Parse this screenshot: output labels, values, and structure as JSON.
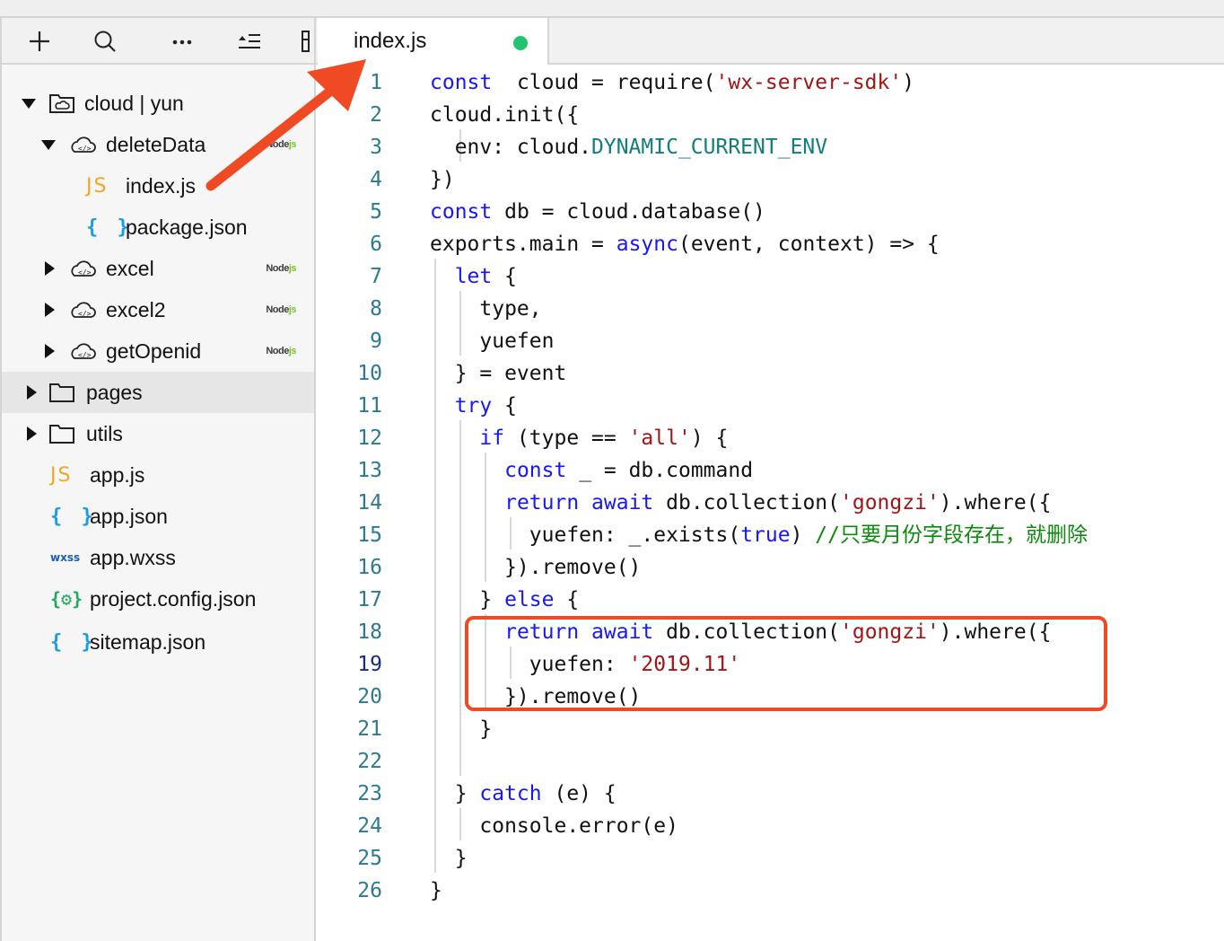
{
  "toolbar": {
    "buttons": [
      {
        "name": "add-icon",
        "glyph": "+"
      },
      {
        "name": "search-icon"
      },
      {
        "name": "more-icon"
      },
      {
        "name": "collapse-icon"
      },
      {
        "name": "split-icon"
      }
    ]
  },
  "tree": [
    {
      "label": "cloud | yun",
      "icon": "cloud-folder",
      "expanded": true
    },
    {
      "label": "deleteData",
      "icon": "cloud-function",
      "expanded": true,
      "badge": [
        "Node",
        "js"
      ]
    },
    {
      "label": "index.js",
      "icon": "js-file",
      "icon_text": "JS"
    },
    {
      "label": "package.json",
      "icon": "json-file",
      "icon_text": "{ }"
    },
    {
      "label": "excel",
      "icon": "cloud-function",
      "expanded": false,
      "badge": [
        "Node",
        "js"
      ]
    },
    {
      "label": "excel2",
      "icon": "cloud-function",
      "expanded": false,
      "badge": [
        "Node",
        "js"
      ]
    },
    {
      "label": "getOpenid",
      "icon": "cloud-function",
      "expanded": false,
      "badge": [
        "Node",
        "js"
      ]
    },
    {
      "label": "pages",
      "icon": "folder",
      "expanded": false,
      "selected": true
    },
    {
      "label": "utils",
      "icon": "folder",
      "expanded": false
    },
    {
      "label": "app.js",
      "icon": "js-file",
      "icon_text": "JS"
    },
    {
      "label": "app.json",
      "icon": "json-file",
      "icon_text": "{ }"
    },
    {
      "label": "app.wxss",
      "icon": "wxss-file",
      "icon_text": "wxss"
    },
    {
      "label": "project.config.json",
      "icon": "config-file",
      "icon_text": "{⚙}"
    },
    {
      "label": "sitemap.json",
      "icon": "json-file",
      "icon_text": "{ }"
    }
  ],
  "tabs": [
    {
      "label": "index.js",
      "modified": true
    }
  ],
  "editor": {
    "current_line": 19,
    "lines": [
      {
        "n": "1",
        "tokens": [
          [
            "kw",
            "const"
          ],
          [
            "",
            "  cloud = require("
          ],
          [
            "str",
            "'wx-server-sdk'"
          ],
          [
            "",
            ")"
          ]
        ]
      },
      {
        "n": "2",
        "tokens": [
          [
            "",
            "cloud.init({"
          ]
        ]
      },
      {
        "n": "3",
        "tokens": [
          [
            "",
            "  env: cloud."
          ],
          [
            "prop",
            "DYNAMIC_CURRENT_ENV"
          ]
        ]
      },
      {
        "n": "4",
        "tokens": [
          [
            "",
            "})"
          ]
        ]
      },
      {
        "n": "5",
        "tokens": [
          [
            "kw",
            "const"
          ],
          [
            "",
            " db = cloud.database()"
          ]
        ]
      },
      {
        "n": "6",
        "tokens": [
          [
            "",
            "exports.main = "
          ],
          [
            "kw",
            "async"
          ],
          [
            "",
            "(event, context) => {"
          ]
        ]
      },
      {
        "n": "7",
        "tokens": [
          [
            "",
            "  "
          ],
          [
            "kw",
            "let"
          ],
          [
            "",
            " {"
          ]
        ]
      },
      {
        "n": "8",
        "tokens": [
          [
            "",
            "    type,"
          ]
        ]
      },
      {
        "n": "9",
        "tokens": [
          [
            "",
            "    yuefen"
          ]
        ]
      },
      {
        "n": "10",
        "tokens": [
          [
            "",
            "  } = event"
          ]
        ]
      },
      {
        "n": "11",
        "tokens": [
          [
            "",
            "  "
          ],
          [
            "kw",
            "try"
          ],
          [
            "",
            " {"
          ]
        ]
      },
      {
        "n": "12",
        "tokens": [
          [
            "",
            "    "
          ],
          [
            "kw",
            "if"
          ],
          [
            "",
            " (type == "
          ],
          [
            "str",
            "'all'"
          ],
          [
            "",
            ") {"
          ]
        ]
      },
      {
        "n": "13",
        "tokens": [
          [
            "",
            "      "
          ],
          [
            "kw",
            "const"
          ],
          [
            "",
            " _ = db.command"
          ]
        ]
      },
      {
        "n": "14",
        "tokens": [
          [
            "",
            "      "
          ],
          [
            "kw",
            "return"
          ],
          [
            "",
            " "
          ],
          [
            "kw",
            "await"
          ],
          [
            "",
            " db.collection("
          ],
          [
            "str",
            "'gongzi'"
          ],
          [
            "",
            ").where({"
          ]
        ]
      },
      {
        "n": "15",
        "tokens": [
          [
            "",
            "        yuefen: _.exists("
          ],
          [
            "kw",
            "true"
          ],
          [
            "",
            ") "
          ],
          [
            "cmt",
            "//只要月份字段存在，就删除"
          ]
        ]
      },
      {
        "n": "16",
        "tokens": [
          [
            "",
            "      }).remove()"
          ]
        ]
      },
      {
        "n": "17",
        "tokens": [
          [
            "",
            "    } "
          ],
          [
            "kw",
            "else"
          ],
          [
            "",
            " {"
          ]
        ]
      },
      {
        "n": "18",
        "tokens": [
          [
            "",
            "      "
          ],
          [
            "kw",
            "return"
          ],
          [
            "",
            " "
          ],
          [
            "kw",
            "await"
          ],
          [
            "",
            " db.collection("
          ],
          [
            "str",
            "'gongzi'"
          ],
          [
            "",
            ").where({"
          ]
        ]
      },
      {
        "n": "19",
        "tokens": [
          [
            "",
            "        yuefen: "
          ],
          [
            "str",
            "'2019.11'"
          ]
        ]
      },
      {
        "n": "20",
        "tokens": [
          [
            "",
            "      }).remove()"
          ]
        ]
      },
      {
        "n": "21",
        "tokens": [
          [
            "",
            "    }"
          ]
        ]
      },
      {
        "n": "22",
        "tokens": []
      },
      {
        "n": "23",
        "tokens": [
          [
            "",
            "  } "
          ],
          [
            "kw",
            "catch"
          ],
          [
            "",
            " (e) {"
          ]
        ]
      },
      {
        "n": "24",
        "tokens": [
          [
            "",
            "    console.error(e)"
          ]
        ]
      },
      {
        "n": "25",
        "tokens": [
          [
            "",
            "  }"
          ]
        ]
      },
      {
        "n": "26",
        "tokens": [
          [
            "",
            "}"
          ]
        ]
      }
    ]
  },
  "annotations": {
    "arrow_color": "#f04a25",
    "highlight_color": "#f04a25"
  }
}
